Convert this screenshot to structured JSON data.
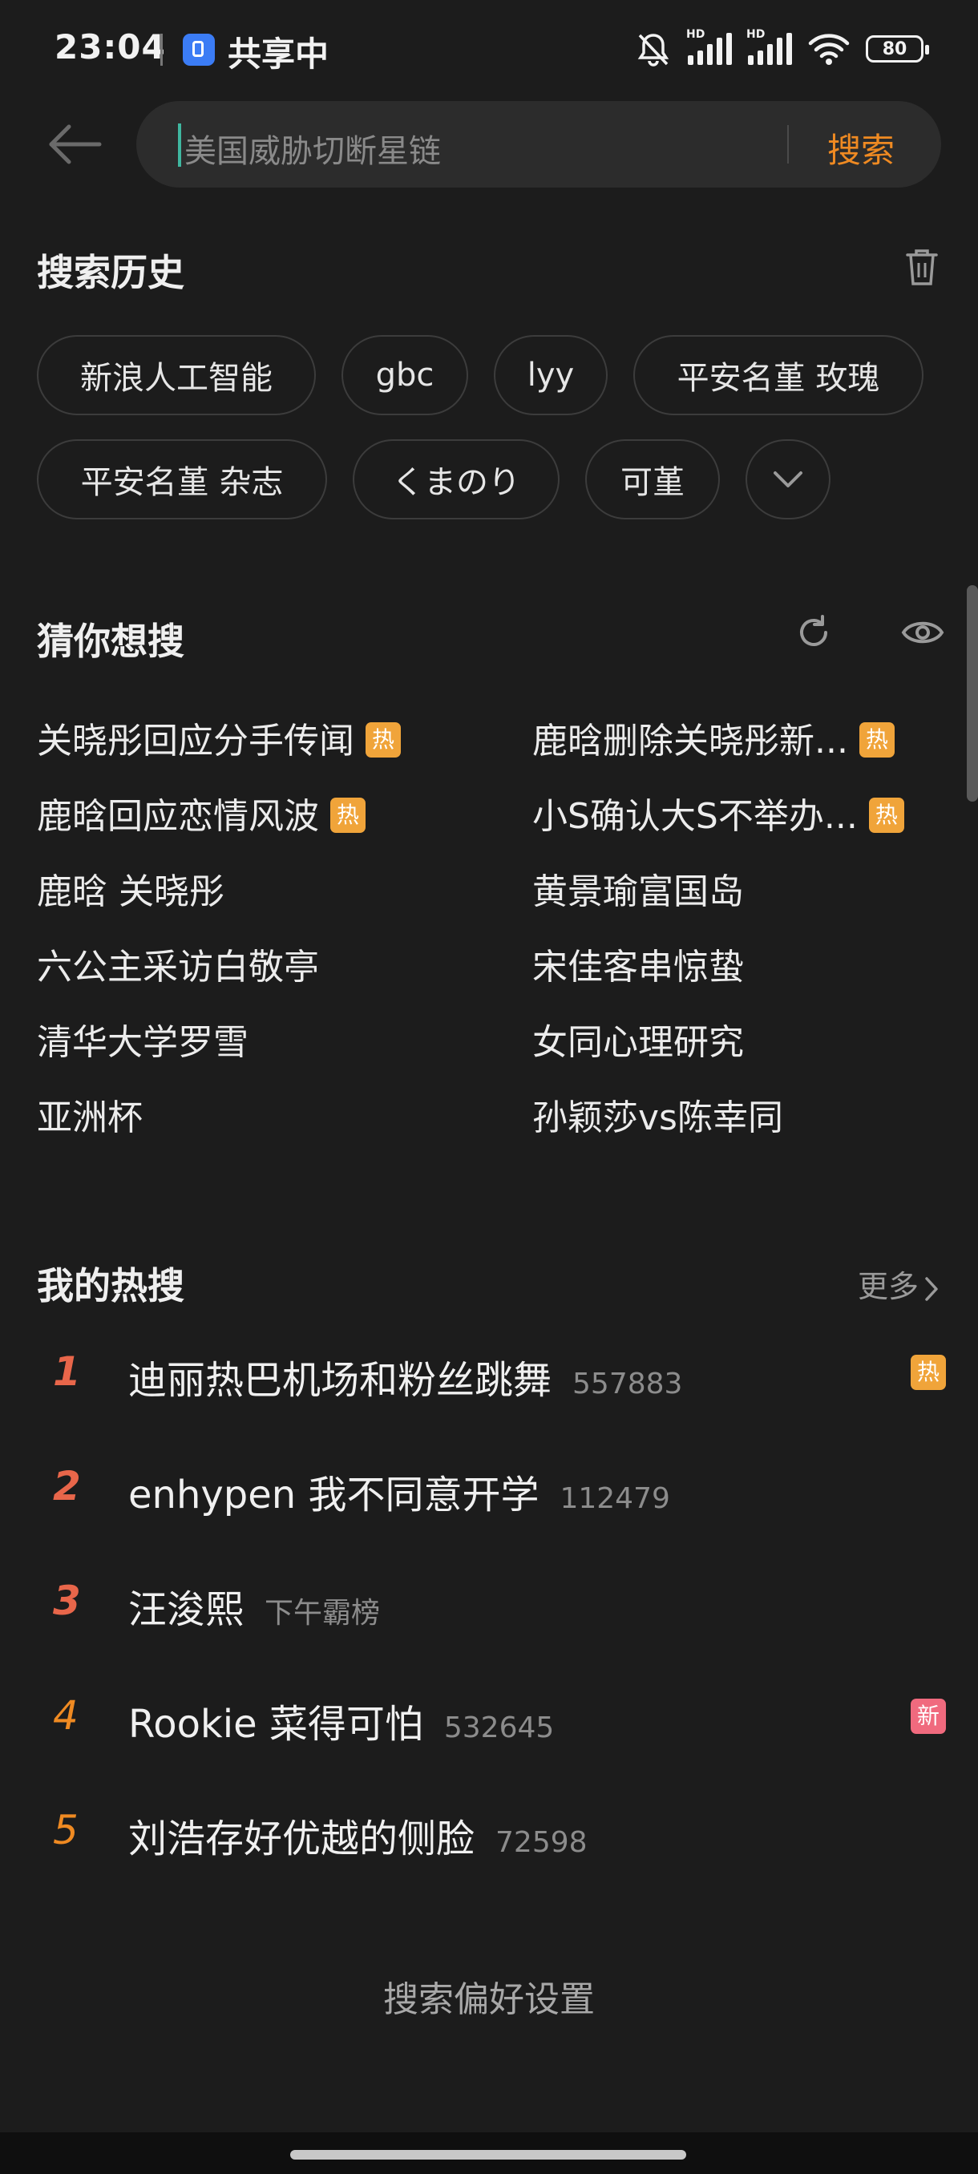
{
  "status_bar": {
    "time": "23:04",
    "share_label": "共享中",
    "hd1": "HD",
    "hd2": "HD",
    "battery": "80"
  },
  "search": {
    "placeholder": "美国威胁切断星链",
    "button_label": "搜索"
  },
  "history": {
    "title": "搜索历史",
    "items": [
      "新浪人工智能",
      "gbc",
      "lyy",
      "平安名堇 玫瑰",
      "平安名堇 杂志",
      "くまのり",
      "可堇"
    ]
  },
  "guess": {
    "title": "猜你想搜",
    "items": [
      {
        "text": "关晓彤回应分手传闻",
        "tag": "热"
      },
      {
        "text": "鹿晗删除关晓彤新...",
        "tag": "热"
      },
      {
        "text": "鹿晗回应恋情风波",
        "tag": "热"
      },
      {
        "text": "小S确认大S不举办...",
        "tag": "热"
      },
      {
        "text": "鹿晗 关晓彤",
        "tag": ""
      },
      {
        "text": "黄景瑜富国岛",
        "tag": ""
      },
      {
        "text": "六公主采访白敬亭",
        "tag": ""
      },
      {
        "text": "宋佳客串惊蛰",
        "tag": ""
      },
      {
        "text": "清华大学罗雪",
        "tag": ""
      },
      {
        "text": "女同心理研究",
        "tag": ""
      },
      {
        "text": "亚洲杯",
        "tag": ""
      },
      {
        "text": "孙颖莎vs陈幸同",
        "tag": ""
      }
    ]
  },
  "hot": {
    "title": "我的热搜",
    "more_label": "更多",
    "items": [
      {
        "rank": "1",
        "title": "迪丽热巴机场和粉丝跳舞",
        "count": "557883",
        "tag": "热"
      },
      {
        "rank": "2",
        "title": "enhypen 我不同意开学",
        "count": "112479",
        "tag": ""
      },
      {
        "rank": "3",
        "title": "汪浚熙",
        "count": "下午霸榜",
        "tag": ""
      },
      {
        "rank": "4",
        "title": "Rookie 菜得可怕",
        "count": "532645",
        "tag": "新"
      },
      {
        "rank": "5",
        "title": "刘浩存好优越的侧脸",
        "count": "72598",
        "tag": ""
      }
    ]
  },
  "prefs_label": "搜索偏好设置",
  "colors": {
    "background": "#1c1c1c",
    "accent": "#ef8a22",
    "rank_top": "#e8664a",
    "rank_rest": "#ef8a22",
    "tag_hot": "#f0a43a",
    "tag_new": "#f06a7e"
  }
}
